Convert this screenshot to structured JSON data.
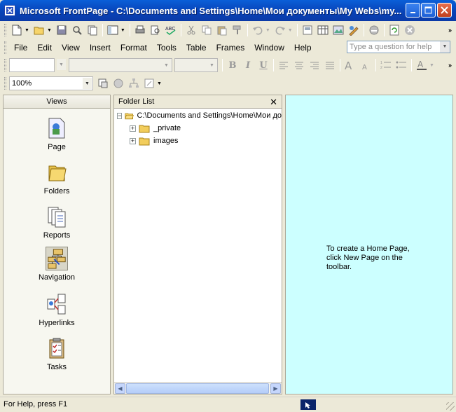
{
  "window": {
    "title": "Microsoft FrontPage - C:\\Documents and Settings\\Home\\Мои документы\\My Webs\\my..."
  },
  "menu": {
    "items": [
      "File",
      "Edit",
      "View",
      "Insert",
      "Format",
      "Tools",
      "Table",
      "Frames",
      "Window",
      "Help"
    ],
    "help_placeholder": "Type a question for help"
  },
  "format_toolbar": {
    "style_value": "",
    "font_value": "",
    "size_value": ""
  },
  "position_toolbar": {
    "zoom": "100%"
  },
  "views": {
    "header": "Views",
    "items": [
      {
        "label": "Page",
        "icon": "page-view-icon"
      },
      {
        "label": "Folders",
        "icon": "folders-view-icon"
      },
      {
        "label": "Reports",
        "icon": "reports-view-icon"
      },
      {
        "label": "Navigation",
        "icon": "navigation-view-icon"
      },
      {
        "label": "Hyperlinks",
        "icon": "hyperlinks-view-icon"
      },
      {
        "label": "Tasks",
        "icon": "tasks-view-icon"
      }
    ],
    "selected": "Navigation"
  },
  "folder_list": {
    "header": "Folder List",
    "root": "C:\\Documents and Settings\\Home\\Мои до",
    "children": [
      "_private",
      "images"
    ]
  },
  "editor": {
    "message": "To create a Home Page, click New Page on the toolbar.",
    "background": "#ccffff"
  },
  "status": {
    "text": "For Help, press F1"
  },
  "colors": {
    "title_bar": "#0a5fd8",
    "chrome": "#ece9d8",
    "close_button": "#c0401d"
  }
}
